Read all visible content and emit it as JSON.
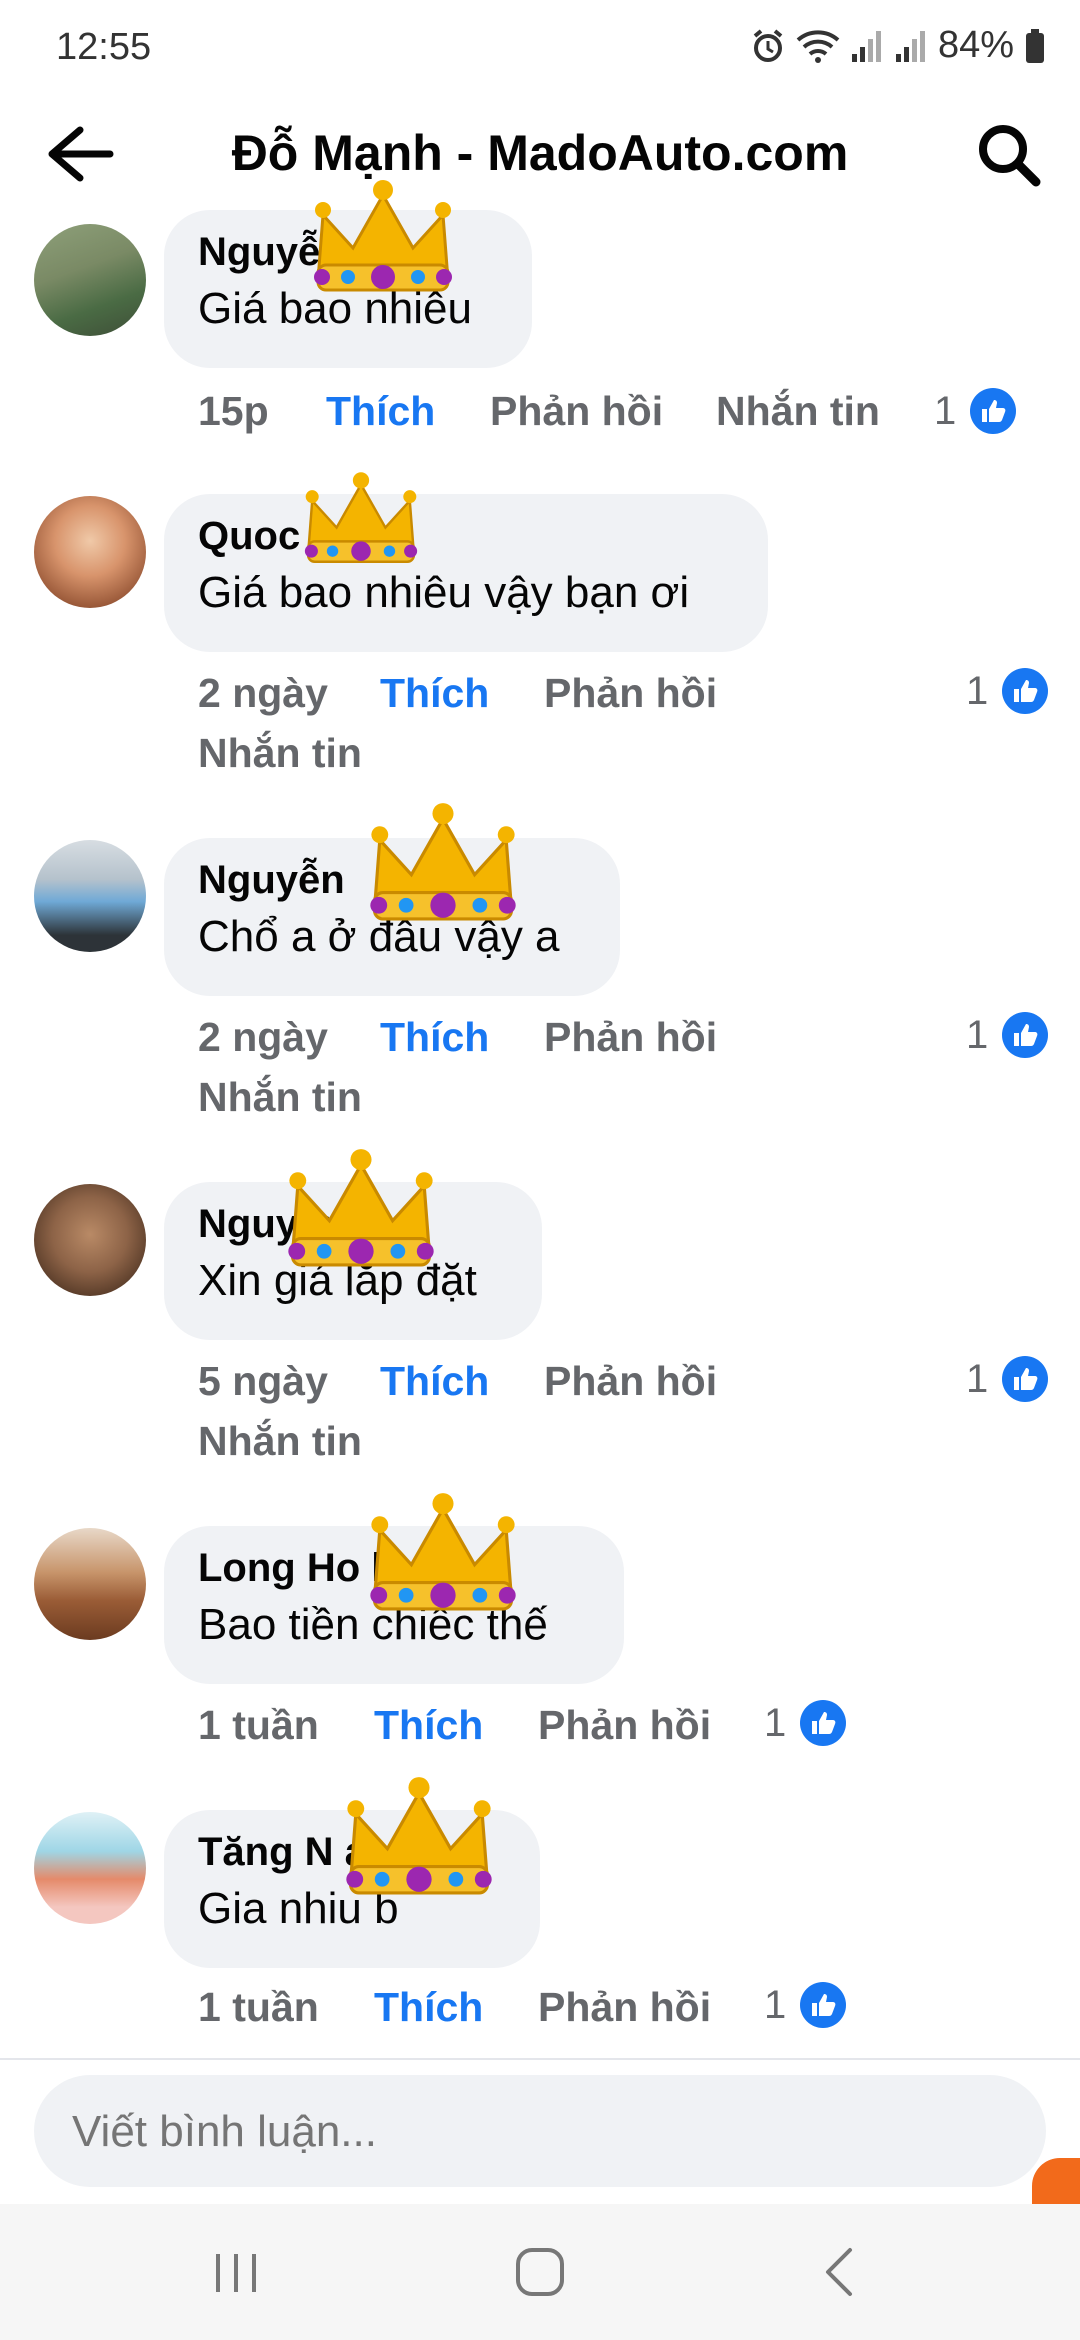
{
  "status": {
    "time": "12:55",
    "battery": "84%"
  },
  "header": {
    "title": "Đỗ Mạnh - MadoAuto.com",
    "back_icon": "back-arrow-icon",
    "search_icon": "search-icon"
  },
  "comments": [
    {
      "author": "Nguyễ",
      "text": "Giá bao nhiêu",
      "time": "15p",
      "like": "Thích",
      "reply": "Phản hồi",
      "message": "Nhắn tin",
      "likes": "1"
    },
    {
      "author": "Quoc         g",
      "text": "Giá bao nhiêu vậy bạn ơi",
      "time": "2 ngày",
      "like": "Thích",
      "reply": "Phản hồi",
      "message": "Nhắn tin",
      "likes": "1"
    },
    {
      "author": "Nguyễn",
      "text": "Chổ a ở đâu vậy a",
      "time": "2 ngày",
      "like": "Thích",
      "reply": "Phản hồi",
      "message": "Nhắn tin",
      "likes": "1"
    },
    {
      "author": "Nguy           n",
      "text": "Xin giá lắp đặt",
      "time": "5 ngày",
      "like": "Thích",
      "reply": "Phản hồi",
      "message": "Nhắn tin",
      "likes": "1"
    },
    {
      "author": "Long Ho            h",
      "text": "Bao tiền chiếc thế",
      "time": "1 tuần",
      "like": "Thích",
      "reply": "Phản hồi",
      "likes": "1"
    },
    {
      "author": "Tăng N            a",
      "text": "Gia nhiu b",
      "time": "1 tuần",
      "like": "Thích",
      "reply": "Phản hồi",
      "likes": "1"
    }
  ],
  "composer": {
    "placeholder": "Viết bình luận..."
  },
  "colors": {
    "accent": "#1877f2",
    "bubble": "#f0f2f5",
    "muted": "#65676b"
  }
}
